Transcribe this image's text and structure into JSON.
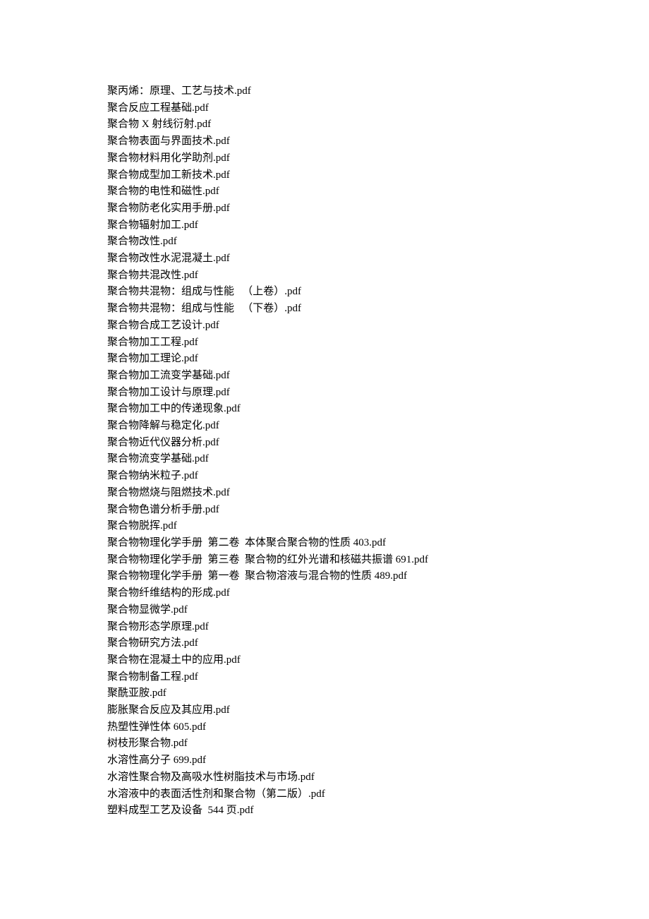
{
  "lines": [
    "聚丙烯：原理、工艺与技术.pdf",
    "聚合反应工程基础.pdf",
    "聚合物 X 射线衍射.pdf",
    "聚合物表面与界面技术.pdf",
    "聚合物材料用化学助剂.pdf",
    "聚合物成型加工新技术.pdf",
    "聚合物的电性和磁性.pdf",
    "聚合物防老化实用手册.pdf",
    "聚合物辐射加工.pdf",
    "聚合物改性.pdf",
    "聚合物改性水泥混凝土.pdf",
    "聚合物共混改性.pdf",
    "聚合物共混物：组成与性能   （上卷）.pdf",
    "聚合物共混物：组成与性能   （下卷）.pdf",
    "聚合物合成工艺设计.pdf",
    "聚合物加工工程.pdf",
    "聚合物加工理论.pdf",
    "聚合物加工流变学基础.pdf",
    "聚合物加工设计与原理.pdf",
    "聚合物加工中的传递现象.pdf",
    "聚合物降解与稳定化.pdf",
    "聚合物近代仪器分析.pdf",
    "聚合物流变学基础.pdf",
    "聚合物纳米粒子.pdf",
    "聚合物燃烧与阻燃技术.pdf",
    "聚合物色谱分析手册.pdf",
    "聚合物脱挥.pdf",
    "聚合物物理化学手册  第二卷  本体聚合聚合物的性质 403.pdf",
    "聚合物物理化学手册  第三卷  聚合物的红外光谱和核磁共振谱 691.pdf",
    "聚合物物理化学手册  第一卷  聚合物溶液与混合物的性质 489.pdf",
    "聚合物纤维结构的形成.pdf",
    "聚合物显微学.pdf",
    "聚合物形态学原理.pdf",
    "聚合物研究方法.pdf",
    "聚合物在混凝土中的应用.pdf",
    "聚合物制备工程.pdf",
    "聚酰亚胺.pdf",
    "膨胀聚合反应及其应用.pdf",
    "热塑性弹性体 605.pdf",
    "树枝形聚合物.pdf",
    "水溶性高分子 699.pdf",
    "水溶性聚合物及高吸水性树脂技术与市场.pdf",
    "水溶液中的表面活性剂和聚合物（第二版）.pdf",
    "塑料成型工艺及设备  544 页.pdf"
  ]
}
